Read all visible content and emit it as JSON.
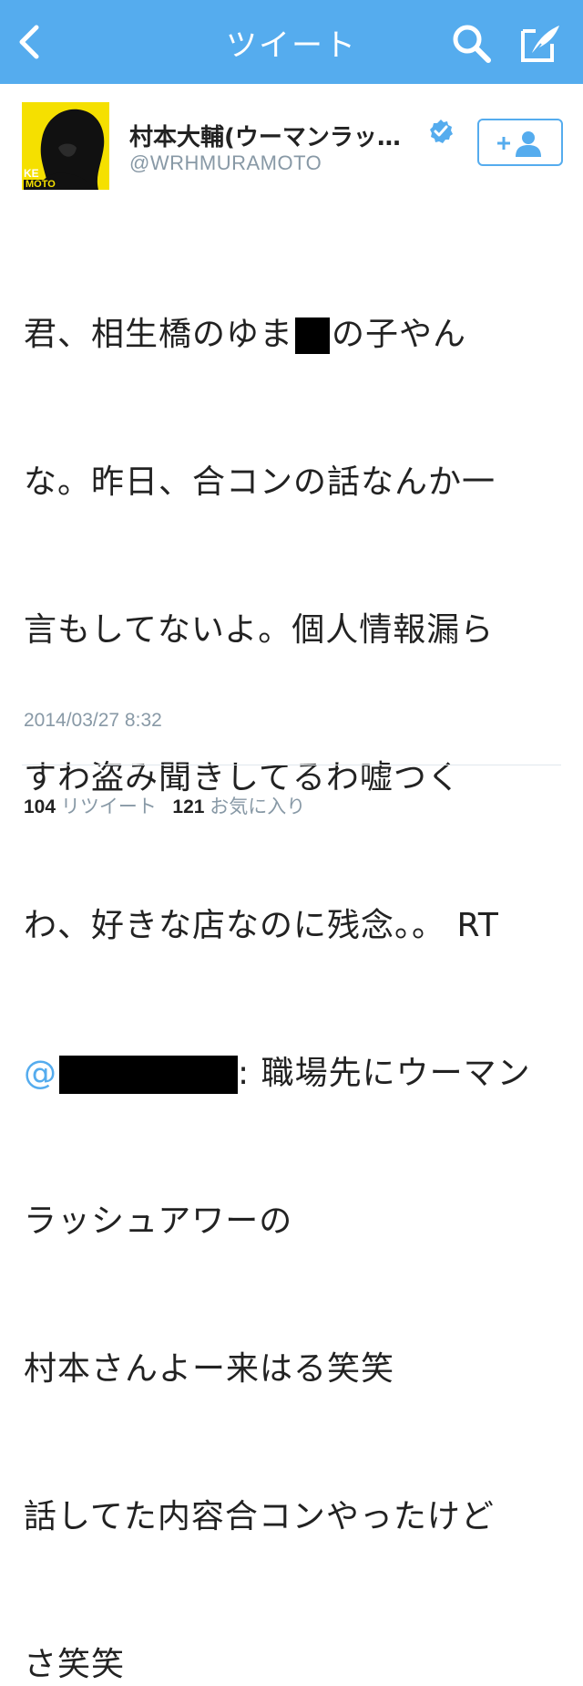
{
  "nav": {
    "title": "ツイート",
    "back_icon": "back-chevron-icon",
    "search_icon": "search-icon",
    "compose_icon": "compose-icon",
    "bar_color": "#55acee"
  },
  "tweet": {
    "author_name": "村本大輔(ウーマンラッ…",
    "author_handle": "@WRHMURAMOTO",
    "verified": true,
    "avatar_text_1": "KE",
    "avatar_text_2": "MOTO",
    "follow_icon": "add-user-icon",
    "text_lines": [
      {
        "a": "君、相生橋のゆま",
        "b": "の子やん"
      },
      {
        "a": "な。昨日、合コンの話なんか一"
      },
      {
        "a": "言もしてないよ。個人情報漏ら"
      },
      {
        "a": "すわ盗み聞きしてるわ嘘つく"
      },
      {
        "a": "わ、好きな店なのに残念。。 RT"
      },
      {
        "mention": "@",
        "b": ": 職場先にウーマン"
      },
      {
        "a": "ラッシュアワーの"
      },
      {
        "a": "村本さんよー来はる笑笑"
      },
      {
        "a": "話してた内容合コンやったけど"
      },
      {
        "a": "さ笑笑"
      }
    ],
    "timestamp": "2014/03/27 8:32",
    "retweet_count": "104",
    "retweet_label": "リツイート",
    "favorite_count": "121",
    "favorite_label": "お気に入り",
    "accent_color": "#55acee"
  }
}
